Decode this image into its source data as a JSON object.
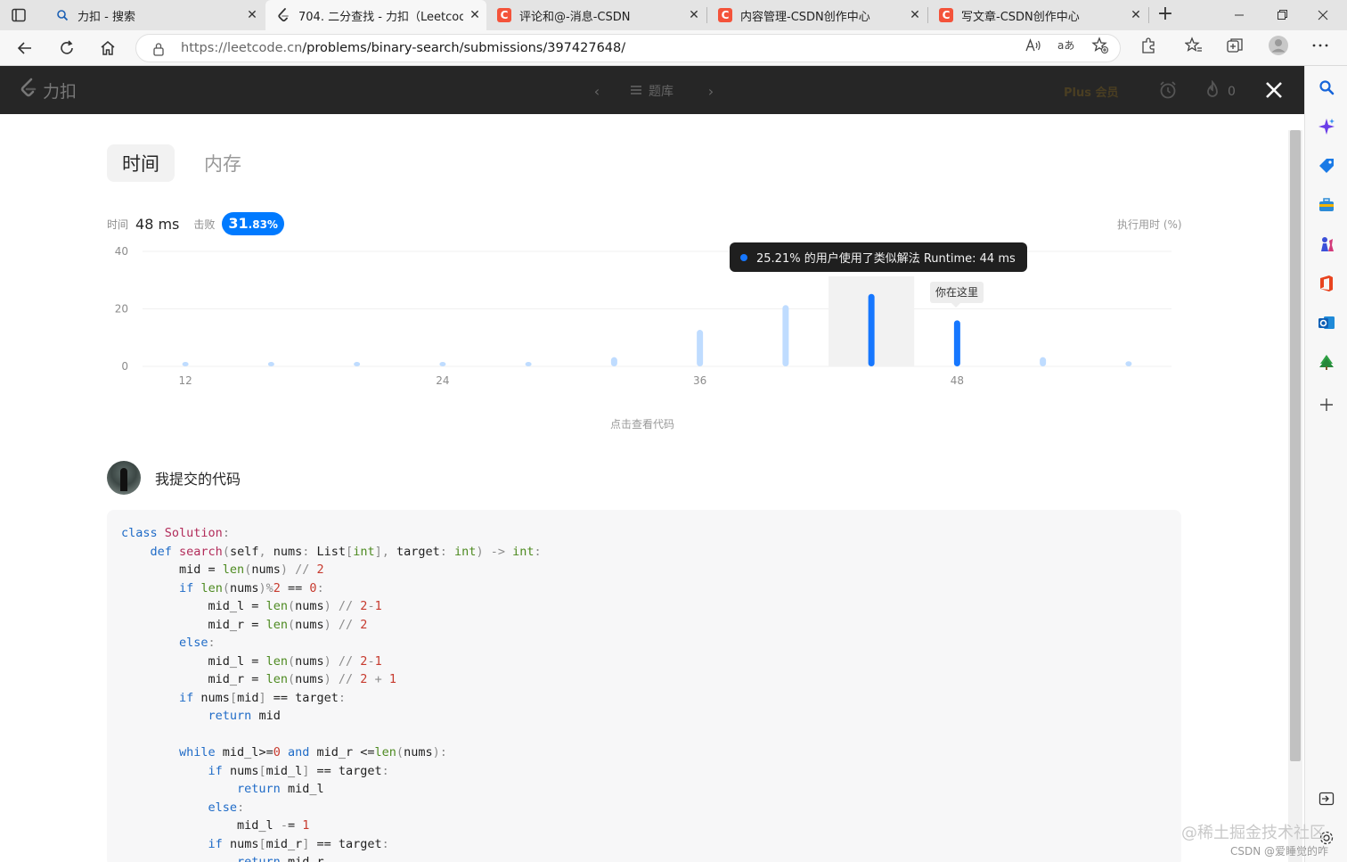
{
  "browser": {
    "tabs": [
      {
        "title": "力扣 - 搜索",
        "icon": "search-icon"
      },
      {
        "title": "704. 二分查找 - 力扣（Leetcode",
        "icon": "leetcode-icon"
      },
      {
        "title": "评论和@-消息-CSDN",
        "icon": "csdn-icon"
      },
      {
        "title": "内容管理-CSDN创作中心",
        "icon": "csdn-icon"
      },
      {
        "title": "写文章-CSDN创作中心",
        "icon": "csdn-icon"
      }
    ],
    "csdn_glyph": "C",
    "close_glyph": "✕",
    "new_tab_glyph": "+",
    "url_host": "https://leetcode.cn",
    "url_path": "/problems/binary-search/submissions/397427648/"
  },
  "header": {
    "logo_text": "力扣",
    "problem_list": "题库",
    "plus_text": "Plus 会员",
    "streak_count": "0"
  },
  "tabs": {
    "time": "时间",
    "memory": "内存"
  },
  "stats": {
    "time_label": "时间",
    "time_value": "48 ms",
    "beat_label": "击败",
    "beat_int": "31",
    "beat_dec": ".83%",
    "right_label": "执行用时 (%)"
  },
  "chart_data": {
    "type": "bar",
    "x": [
      12,
      16,
      20,
      24,
      28,
      32,
      36,
      40,
      44,
      48,
      52,
      56
    ],
    "values": [
      0.3,
      0.3,
      0.3,
      0.3,
      0.3,
      3.2,
      12.7,
      21.3,
      25.21,
      16.0,
      3.2,
      1.8
    ],
    "xticks": [
      "12",
      "24",
      "36",
      "48"
    ],
    "yticks": [
      "0",
      "20",
      "40"
    ],
    "ylim": [
      0,
      40
    ],
    "highlight_x": [
      44,
      48
    ],
    "hovered_x": 44,
    "grid": true,
    "colors": {
      "bar": "#bfdcff",
      "highlight": "#1677ff",
      "hover_band": "#f2f2f2",
      "grid": "#f0f0f0"
    }
  },
  "tooltip": {
    "text": "25.21% 的用户使用了类似解法 Runtime: 44 ms"
  },
  "marker": {
    "text": "你在这里"
  },
  "view_code": "点击查看代码",
  "my_code": {
    "title": "我提交的代码"
  },
  "code_lines": [
    "class Solution:",
    "    def search(self, nums: List[int], target: int) -> int:",
    "        mid = len(nums) // 2",
    "        if len(nums)%2 == 0:",
    "            mid_l = len(nums) // 2-1",
    "            mid_r = len(nums) // 2",
    "        else:",
    "            mid_l = len(nums) // 2-1",
    "            mid_r = len(nums) // 2 + 1",
    "        if nums[mid] == target:",
    "            return mid",
    "",
    "        while mid_l>=0 and mid_r <=len(nums):",
    "            if nums[mid_l] == target:",
    "                return mid_l",
    "            else:",
    "                mid_l -= 1",
    "            if nums[mid_r] == target:",
    "                return mid_r"
  ],
  "watermark": {
    "main": "@稀土掘金技术社区",
    "sub": "CSDN @爱睡觉的咋"
  }
}
